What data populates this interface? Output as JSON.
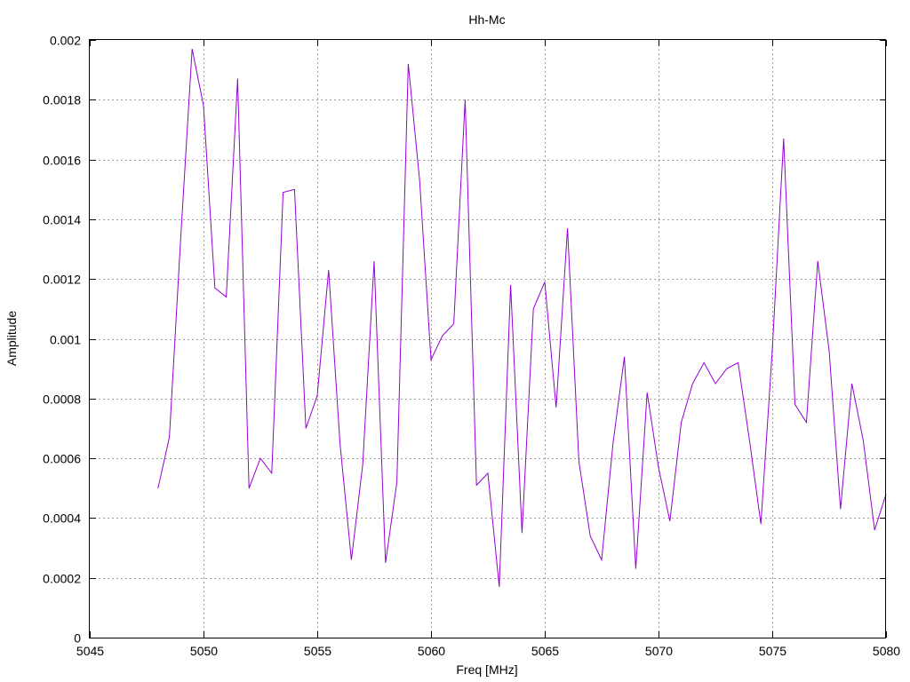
{
  "chart_data": {
    "type": "line",
    "title": "Hh-Mc",
    "xlabel": "Freq [MHz]",
    "ylabel": "Amplitude",
    "xlim": [
      5045,
      5080
    ],
    "ylim": [
      0,
      0.002
    ],
    "xticks": [
      "5045",
      "5050",
      "5055",
      "5060",
      "5065",
      "5070",
      "5075",
      "5080"
    ],
    "xtick_values": [
      5045,
      5050,
      5055,
      5060,
      5065,
      5070,
      5075,
      5080
    ],
    "yticks": [
      "0",
      "0.0002",
      "0.0004",
      "0.0006",
      "0.0008",
      "0.001",
      "0.0012",
      "0.0014",
      "0.0016",
      "0.0018",
      "0.002"
    ],
    "ytick_values": [
      0,
      0.0002,
      0.0004,
      0.0006,
      0.0008,
      0.001,
      0.0012,
      0.0014,
      0.0016,
      0.0018,
      0.002
    ],
    "grid": true,
    "line_color": "#9400d3",
    "series": [
      {
        "x": [
          5048.0,
          5048.5,
          5049.0,
          5049.5,
          5050.0,
          5050.5,
          5051.0,
          5051.5,
          5052.0,
          5052.5,
          5053.0,
          5053.5,
          5054.0,
          5054.5,
          5055.0,
          5055.5,
          5056.0,
          5056.5,
          5057.0,
          5057.5,
          5058.0,
          5058.5,
          5059.0,
          5059.5,
          5060.0,
          5060.5,
          5061.0,
          5061.5,
          5062.0,
          5062.5,
          5063.0,
          5063.5,
          5064.0,
          5064.5,
          5065.0,
          5065.5,
          5066.0,
          5066.5,
          5067.0,
          5067.5,
          5068.0,
          5068.5,
          5069.0,
          5069.5,
          5070.0,
          5070.5,
          5071.0,
          5071.5,
          5072.0,
          5072.5,
          5073.0,
          5073.5,
          5074.0,
          5074.5,
          5075.0,
          5075.5,
          5076.0,
          5076.5,
          5077.0,
          5077.5,
          5078.0,
          5078.5,
          5079.0,
          5079.5,
          5080.0
        ],
        "y": [
          0.0005,
          0.00067,
          0.00134,
          0.00197,
          0.00178,
          0.00117,
          0.00114,
          0.00187,
          0.0005,
          0.0006,
          0.00055,
          0.00149,
          0.0015,
          0.0007,
          0.00081,
          0.00123,
          0.00065,
          0.00026,
          0.00058,
          0.00126,
          0.00025,
          0.00052,
          0.00192,
          0.00153,
          0.00093,
          0.00101,
          0.00105,
          0.0018,
          0.00051,
          0.00055,
          0.00017,
          0.00118,
          0.00035,
          0.0011,
          0.00119,
          0.00077,
          0.00137,
          0.00059,
          0.00034,
          0.00026,
          0.00065,
          0.00094,
          0.00023,
          0.00082,
          0.00057,
          0.00039,
          0.00072,
          0.00085,
          0.00092,
          0.00085,
          0.0009,
          0.00092,
          0.00066,
          0.00038,
          0.00096,
          0.00167,
          0.00078,
          0.00072,
          0.00126,
          0.00096,
          0.00043,
          0.00085,
          0.00066,
          0.00036,
          0.00048
        ]
      }
    ]
  }
}
